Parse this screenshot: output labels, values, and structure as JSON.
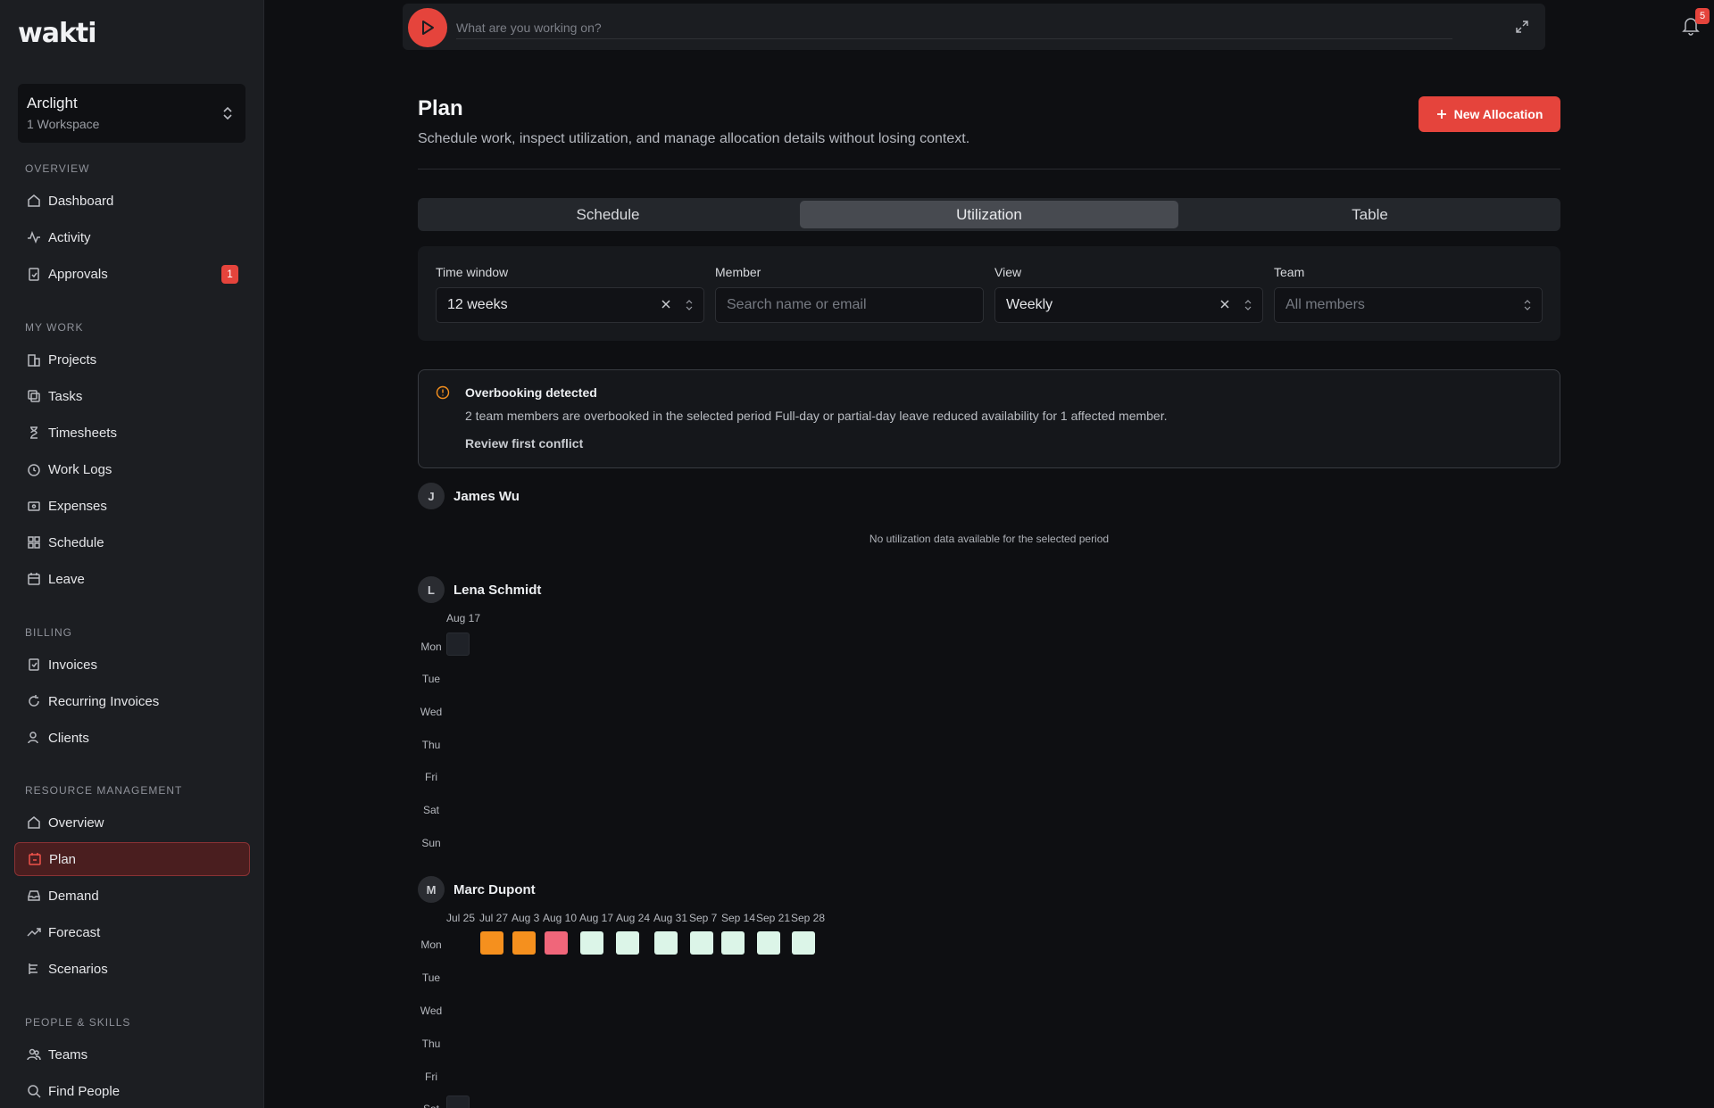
{
  "app": {
    "logo": "wakti"
  },
  "workspace": {
    "name": "Arclight",
    "sub": "1 Workspace"
  },
  "sidebar": {
    "sections": {
      "overview": "OVERVIEW",
      "my_work": "MY WORK",
      "billing": "BILLING",
      "resource": "RESOURCE MANAGEMENT",
      "people": "PEOPLE & SKILLS"
    },
    "items": {
      "dashboard": "Dashboard",
      "activity": "Activity",
      "approvals": "Approvals",
      "approvals_badge": "1",
      "projects": "Projects",
      "tasks": "Tasks",
      "timesheets": "Timesheets",
      "work_logs": "Work Logs",
      "expenses": "Expenses",
      "schedule": "Schedule",
      "leave": "Leave",
      "invoices": "Invoices",
      "recurring": "Recurring Invoices",
      "clients": "Clients",
      "overview": "Overview",
      "plan": "Plan",
      "demand": "Demand",
      "forecast": "Forecast",
      "scenarios": "Scenarios",
      "teams": "Teams",
      "find_people": "Find People"
    }
  },
  "tracker": {
    "placeholder": "What are you working on?"
  },
  "notifications": {
    "count": "5"
  },
  "header": {
    "title": "Plan",
    "subtitle": "Schedule work, inspect utilization, and manage allocation details without losing context.",
    "new_button": "New Allocation"
  },
  "tabs": {
    "schedule": "Schedule",
    "utilization": "Utilization",
    "table": "Table",
    "active": "Utilization"
  },
  "filters": {
    "time_window_label": "Time window",
    "time_window_value": "12 weeks",
    "member_label": "Member",
    "member_placeholder": "Search name or email",
    "view_label": "View",
    "view_value": "Weekly",
    "team_label": "Team",
    "team_placeholder": "All members"
  },
  "alert": {
    "title": "Overbooking detected",
    "description": "2 team members are overbooked in the selected period Full-day or partial-day leave reduced availability for 1 affected member.",
    "link": "Review first conflict"
  },
  "days": [
    "Mon",
    "Tue",
    "Wed",
    "Thu",
    "Fri",
    "Sat",
    "Sun"
  ],
  "members": {
    "james": {
      "initial": "J",
      "name": "James Wu",
      "empty": "No utilization data available for the selected period"
    },
    "lena": {
      "initial": "L",
      "name": "Lena Schmidt",
      "weeks": [
        "Aug 17"
      ]
    },
    "marc": {
      "initial": "M",
      "name": "Marc Dupont",
      "weeks": [
        "Jul 25",
        "Jul 27",
        "Aug 3",
        "Aug 10",
        "Aug 17",
        "Aug 24",
        "Aug 31",
        "Sep 7",
        "Sep 14",
        "Sep 21",
        "Sep 28"
      ]
    }
  },
  "colors": {
    "accent": "#e5443c",
    "overbooked": "#f5901e",
    "critical": "#f0667a",
    "normal": "#dcf5e8",
    "empty": "#1f2228"
  }
}
